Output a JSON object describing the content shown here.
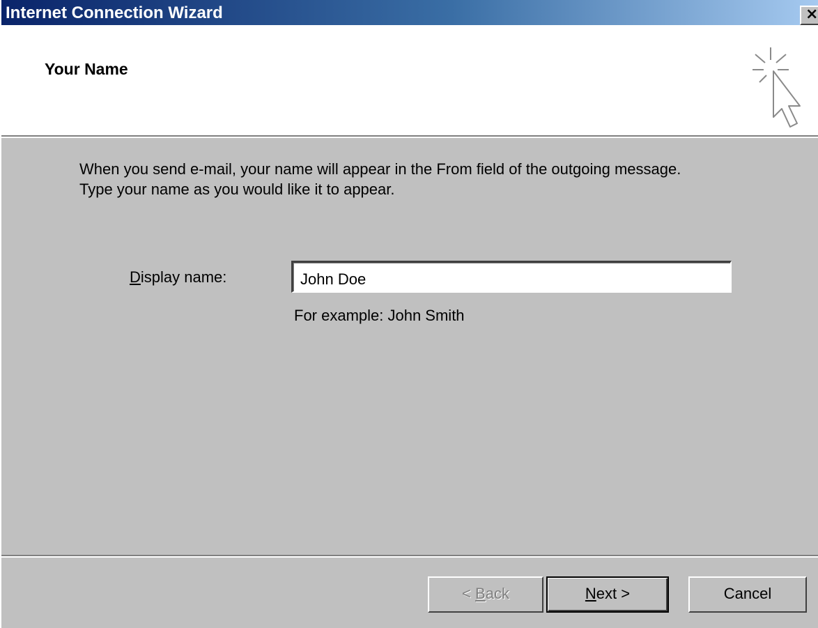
{
  "window": {
    "title": "Internet Connection Wizard",
    "close_label": "×"
  },
  "header": {
    "title": "Your Name",
    "icon": "wizard-cursor-icon"
  },
  "body": {
    "description_line1": "When you send e-mail, your name will appear in the From field of the outgoing message.",
    "description_line2": "Type your name as you would like it to appear.",
    "display_name_label_mnemonic": "D",
    "display_name_label_rest": "isplay name:",
    "display_name_value": "John Doe",
    "example_text": "For example: John Smith"
  },
  "buttons": {
    "back_prefix": "< ",
    "back_mnemonic": "B",
    "back_rest": "ack",
    "back_enabled": false,
    "next_mnemonic": "N",
    "next_rest": "ext >",
    "cancel_label": "Cancel"
  },
  "colors": {
    "titlebar_start": "#0a246a",
    "titlebar_end": "#a6caf0",
    "dialog_face": "#c0c0c0",
    "header_bg": "#ffffff"
  }
}
